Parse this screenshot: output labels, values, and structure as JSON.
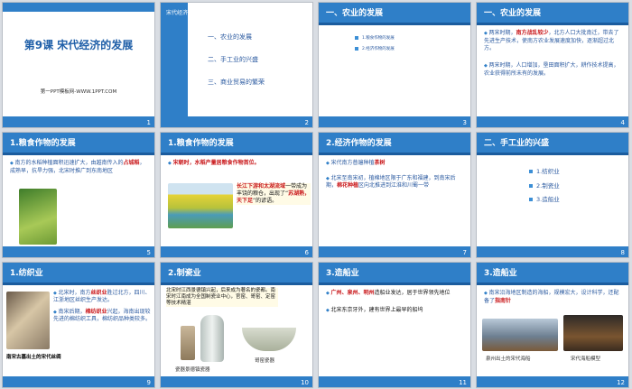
{
  "slides": [
    {
      "num": "1",
      "title": "第9课  宋代经济的发展",
      "sub": "第一PPT模板网-WWW.1PPT.COM"
    },
    {
      "num": "2",
      "header": "宋代经济的发展",
      "items": [
        "一、农业的发展",
        "二、手工业的兴盛",
        "三、商业贸易的繁荣"
      ]
    },
    {
      "num": "3",
      "header": "一、农业的发展",
      "items": [
        "1.粮食作物的发展",
        "2.经济作物的发展"
      ]
    },
    {
      "num": "4",
      "header": "一、农业的发展",
      "p1_pre": "两宋时期，",
      "p1_red": "南方战乱较少",
      "p1_post": "，北方人口大批南迁，带去了先进生产技术，使南方农业发展速度加快，逐渐超过北方。",
      "p2": "两宋时期，人口增加，垦田面积扩大，耕作技术提高，农业获得前所未有的发展。"
    },
    {
      "num": "5",
      "header": "1.粮食作物的发展",
      "p_pre": "南方的水稻种植面积迅速扩大，由越南传入的",
      "p_red": "占城稻",
      "p_post": "，成熟早，抗旱力强，北宋时推广到东南地区"
    },
    {
      "num": "6",
      "header": "1.粮食作物的发展",
      "red1": "宋朝时，水稻产量居粮食作物首位。",
      "p_red1": "长江下游和太湖流域",
      "p_mid": "一带成为丰饶的粮仓，出现了“",
      "p_red2": "苏湖熟，天下足",
      "p_end": "”的谚语。"
    },
    {
      "num": "7",
      "header": "2.经济作物的发展",
      "p1_pre": "宋代南方普遍种植",
      "p1_red": "茶树",
      "p2_pre": "北宋至南宋初，植棉地区限于广东和福建，到南宋后期，",
      "p2_red": "棉花种植",
      "p2_post": "区向北推进到江淮和川蜀一带"
    },
    {
      "num": "8",
      "header": "二、手工业的兴盛",
      "items": [
        "1.纺织业",
        "2.制瓷业",
        "3.造船业"
      ]
    },
    {
      "num": "9",
      "header": "1.纺织业",
      "p1_pre": "北宋时，南方",
      "p1_red": "丝织业",
      "p1_post": "胜过北方，四川、江浙地区丝织生产发达。",
      "p2_pre": "南宋后期，",
      "p2_red": "棉纺织业",
      "p2_post": "兴起，海南出现较先进的棉纺织工具，棉纺织品种类较多。",
      "caption": "南宋古墓出土的宋代丝绸"
    },
    {
      "num": "10",
      "header": "2.制瓷业",
      "text": "北宋时江西景德镇兴起，后来成为著名的瓷都。南宋时江南成为全国制瓷业中心，官窑、哥窑、定窑等技术精湛",
      "cap1": "瓷器景德镇瓷器",
      "cap2": "哥窑瓷器"
    },
    {
      "num": "11",
      "header": "3.造船业",
      "p1_red": "广州、泉州、明州",
      "p1_post": "造船业发达，居于世界领先地位",
      "p2": "北宋东京牙外，建有世界上最早的船坞"
    },
    {
      "num": "12",
      "header": "3.造船业",
      "p_pre": "南宋沿海地区制造的海船，规模宏大，设计科学，还配备了",
      "p_red": "指南针",
      "cap1": "泉州出土的宋代海船",
      "cap2": "宋代海船模型"
    }
  ]
}
